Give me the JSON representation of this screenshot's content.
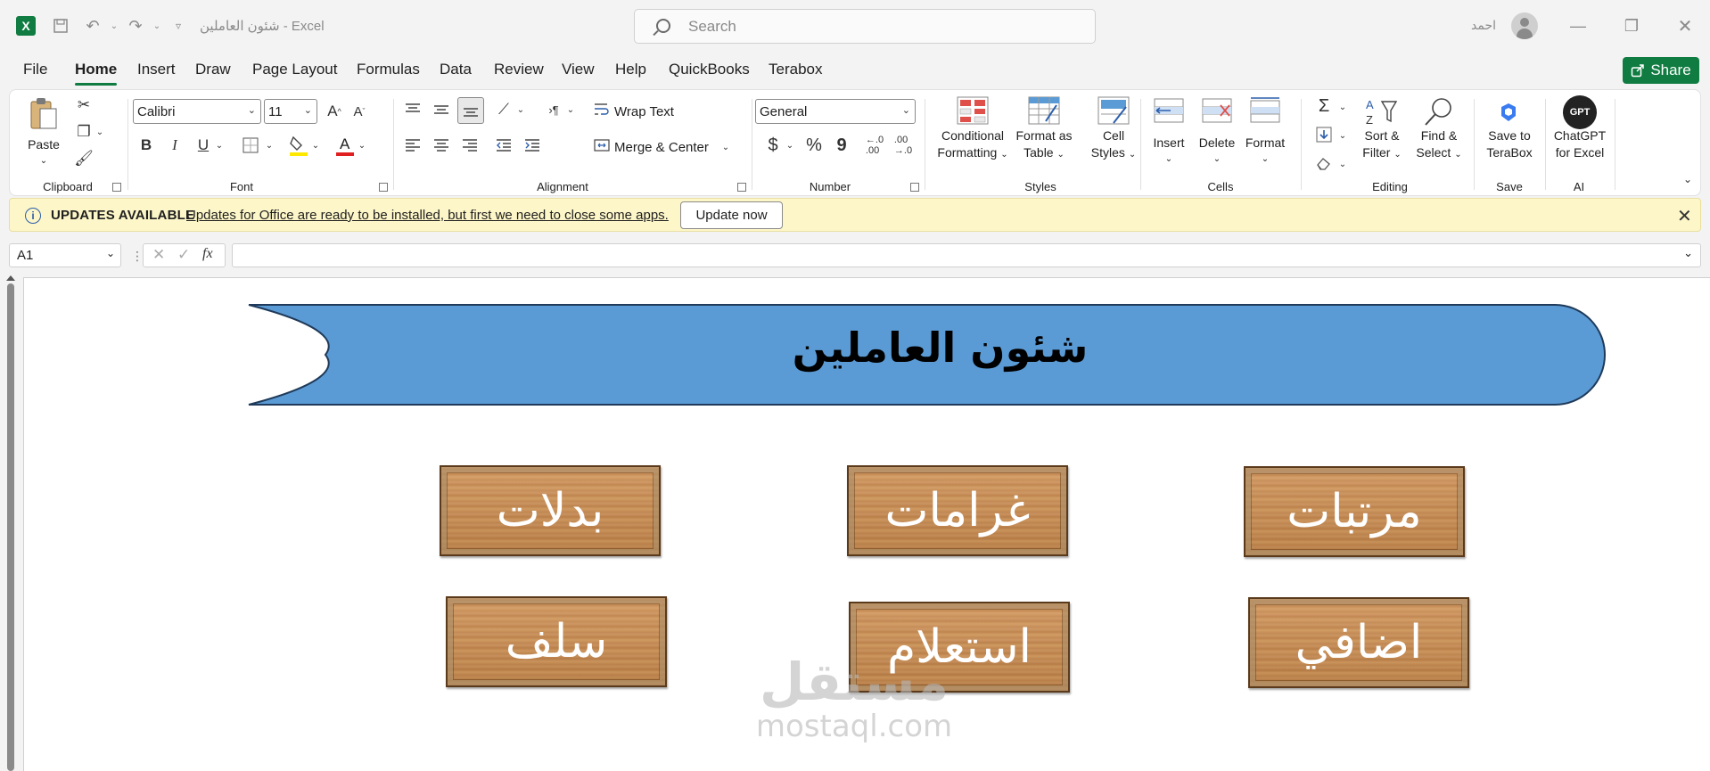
{
  "titlebar": {
    "app_title": "شئون العاملين  -  Excel",
    "search_placeholder": "Search",
    "username": "احمد"
  },
  "menu": {
    "tabs": [
      "File",
      "Home",
      "Insert",
      "Draw",
      "Page Layout",
      "Formulas",
      "Data",
      "Review",
      "View",
      "Help",
      "QuickBooks",
      "Terabox"
    ],
    "active": "Home",
    "share": "Share"
  },
  "ribbon": {
    "clipboard": {
      "paste": "Paste",
      "label": "Clipboard"
    },
    "font": {
      "name": "Calibri",
      "size": "11",
      "bold": "B",
      "italic": "I",
      "underline": "U",
      "label": "Font"
    },
    "alignment": {
      "wrap": "Wrap Text",
      "merge": "Merge & Center",
      "label": "Alignment"
    },
    "number": {
      "format": "General",
      "currency": "$",
      "percent": "%",
      "comma": "9",
      "label": "Number"
    },
    "styles": {
      "conditional": [
        "Conditional",
        "Formatting"
      ],
      "format_table": [
        "Format as",
        "Table"
      ],
      "cell_styles": [
        "Cell",
        "Styles"
      ],
      "label": "Styles"
    },
    "cells": {
      "insert": "Insert",
      "delete": "Delete",
      "format": "Format",
      "label": "Cells"
    },
    "editing": {
      "sort": [
        "Sort &",
        "Filter"
      ],
      "find": [
        "Find &",
        "Select"
      ],
      "label": "Editing"
    },
    "save": {
      "terabox": [
        "Save to",
        "TeraBox"
      ],
      "label": "Save"
    },
    "ai": {
      "chatgpt": [
        "ChatGPT",
        "for Excel"
      ],
      "badge": "GPT",
      "label": "AI"
    }
  },
  "infobar": {
    "title": "UPDATES AVAILABLE",
    "message": "Updates for Office are ready to be installed, but first we need to close some apps.",
    "button": "Update now"
  },
  "formula_bar": {
    "cell_ref": "A1",
    "fx": "fx",
    "value": ""
  },
  "sheet": {
    "banner_title": "شئون العاملين",
    "buttons": [
      {
        "name": "مرتبات"
      },
      {
        "name": "غرامات"
      },
      {
        "name": "بدلات"
      },
      {
        "name": "اضافي"
      },
      {
        "name": "استعلام"
      },
      {
        "name": "سلف"
      }
    ],
    "watermark": {
      "arabic": "مستقل",
      "latin": "mostaql.com"
    }
  },
  "colors": {
    "excel_green": "#107c41",
    "banner_blue": "#5b9bd5",
    "info_yellow": "#fdf6c8",
    "wood": "#c88a4e"
  }
}
